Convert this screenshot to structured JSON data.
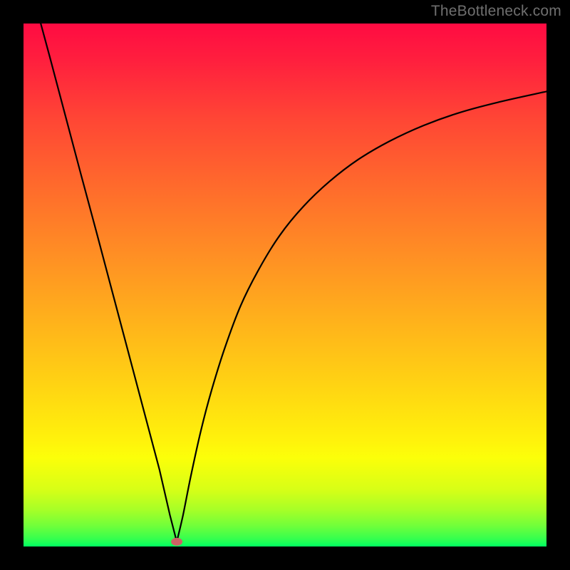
{
  "watermark": {
    "text": "TheBottleneck.com"
  },
  "colors": {
    "frame_border": "#000000",
    "curve_stroke": "#000000",
    "marker_fill": "#cd6165",
    "gradient_stops": [
      {
        "offset": 0.0,
        "color": "#ff0b42"
      },
      {
        "offset": 0.07,
        "color": "#ff1f3e"
      },
      {
        "offset": 0.18,
        "color": "#ff4535"
      },
      {
        "offset": 0.31,
        "color": "#ff6a2c"
      },
      {
        "offset": 0.44,
        "color": "#ff8e24"
      },
      {
        "offset": 0.57,
        "color": "#ffb21b"
      },
      {
        "offset": 0.69,
        "color": "#ffd313"
      },
      {
        "offset": 0.8,
        "color": "#fff30b"
      },
      {
        "offset": 0.83,
        "color": "#fcff09"
      },
      {
        "offset": 0.89,
        "color": "#d8ff16"
      },
      {
        "offset": 0.93,
        "color": "#a7ff27"
      },
      {
        "offset": 0.96,
        "color": "#71ff3a"
      },
      {
        "offset": 0.985,
        "color": "#36ff4e"
      },
      {
        "offset": 1.0,
        "color": "#00ff61"
      }
    ]
  },
  "chart_data": {
    "type": "line",
    "title": "",
    "xlabel": "",
    "ylabel": "",
    "xlim": [
      0,
      100
    ],
    "ylim": [
      0,
      100
    ],
    "marker": {
      "x": 29.3,
      "y": 0.9
    },
    "series": [
      {
        "name": "left-branch",
        "x": [
          3.3,
          5,
          8,
          11,
          14,
          17,
          20,
          23,
          26,
          28,
          29.3
        ],
        "y": [
          100,
          93.7,
          82.4,
          71.1,
          59.9,
          48.6,
          37.3,
          26.0,
          14.7,
          6.0,
          0.9
        ]
      },
      {
        "name": "right-branch",
        "x": [
          29.3,
          30.5,
          32,
          34,
          36,
          38.5,
          41.5,
          45,
          49,
          53.5,
          58.5,
          64,
          70,
          76.5,
          83.5,
          91,
          100
        ],
        "y": [
          0.9,
          6.0,
          13.5,
          22.5,
          30.0,
          38.0,
          46.0,
          53.0,
          59.5,
          65.0,
          69.8,
          74.0,
          77.5,
          80.5,
          83.0,
          85.0,
          87.0
        ]
      }
    ]
  }
}
